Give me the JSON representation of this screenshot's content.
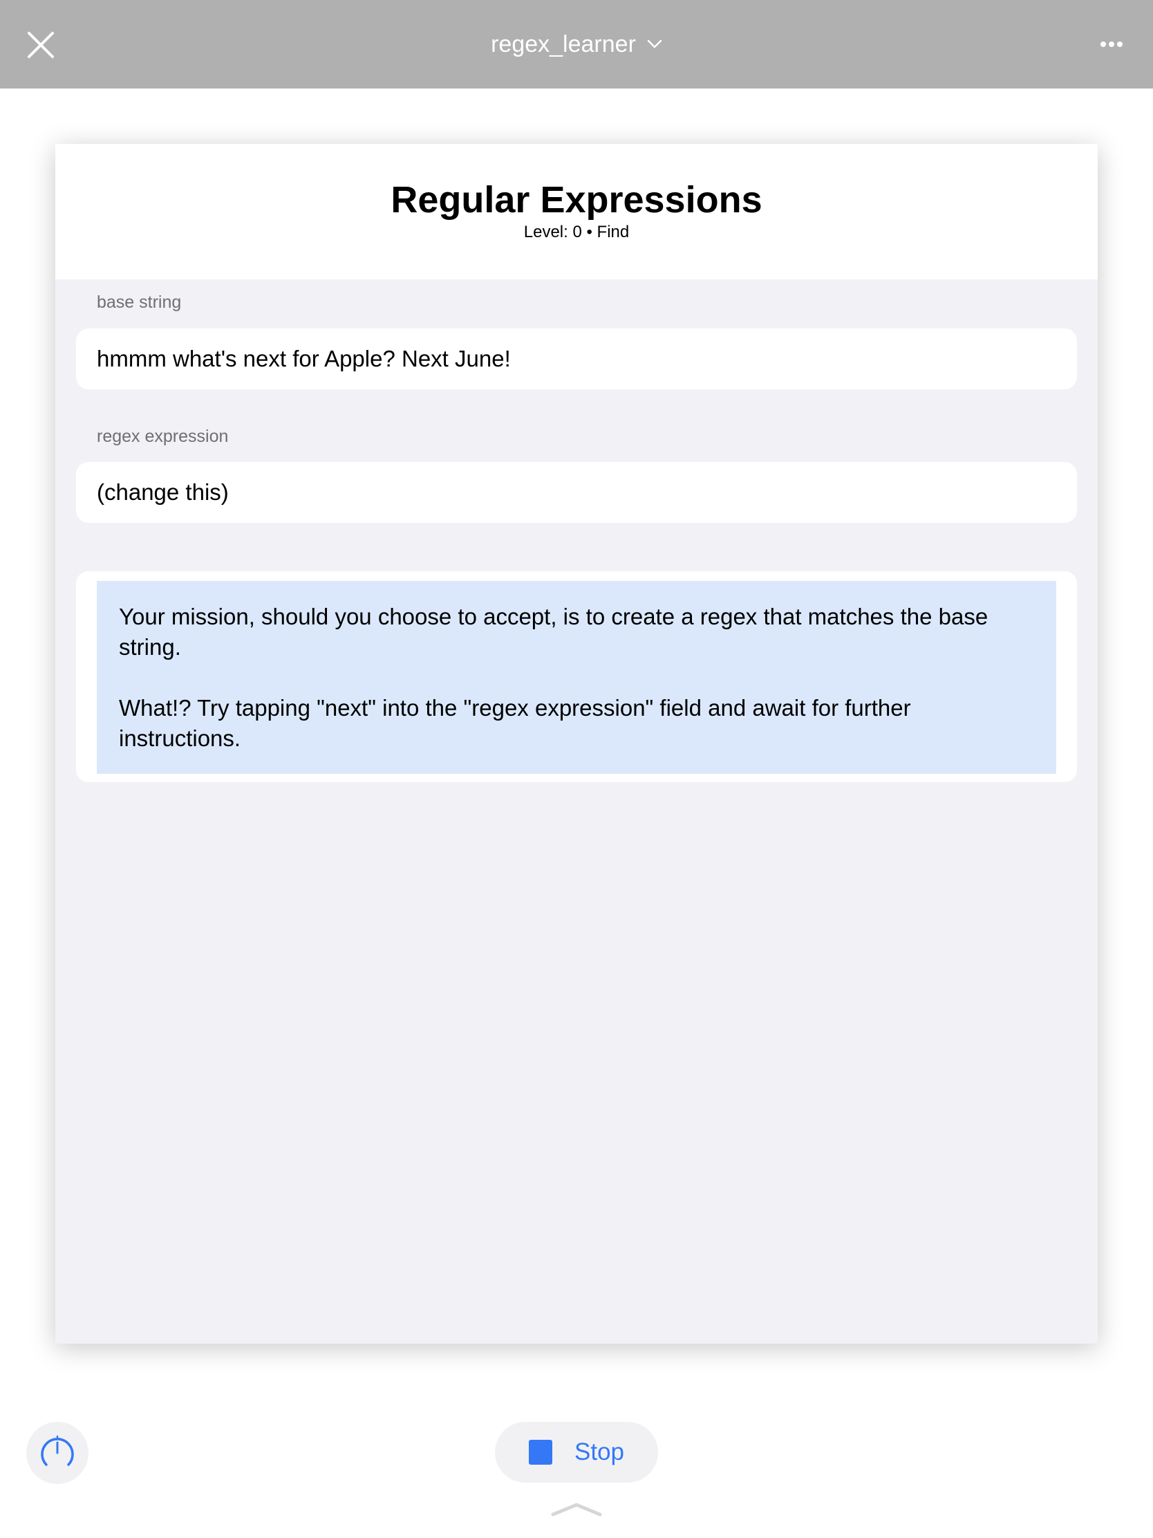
{
  "topbar": {
    "title": "regex_learner",
    "icons": [
      "close-icon",
      "chevron-down-icon",
      "more-icon"
    ]
  },
  "page": {
    "title": "Regular Expressions",
    "subtitle": "Level: 0 • Find"
  },
  "fields": {
    "base_label": "base string",
    "base_value": "hmmm what's next for Apple? Next June!",
    "regex_label": "regex expression",
    "regex_value": "(change this)"
  },
  "instructions": {
    "paragraph1": "Your mission, should you choose to accept, is to create a regex that matches the base string.",
    "paragraph2": "What!? Try tapping \"next\" into the \"regex expression\" field and await for further instructions."
  },
  "bottom": {
    "stop_label": "Stop",
    "icons": [
      "gauge-icon",
      "stop-icon",
      "chevron-up-icon"
    ]
  },
  "colors": {
    "topbar": "#b0b0b0",
    "accent": "#3478f6",
    "instructions_bg": "#dbe8fb",
    "card_bg": "#f2f2f6"
  }
}
